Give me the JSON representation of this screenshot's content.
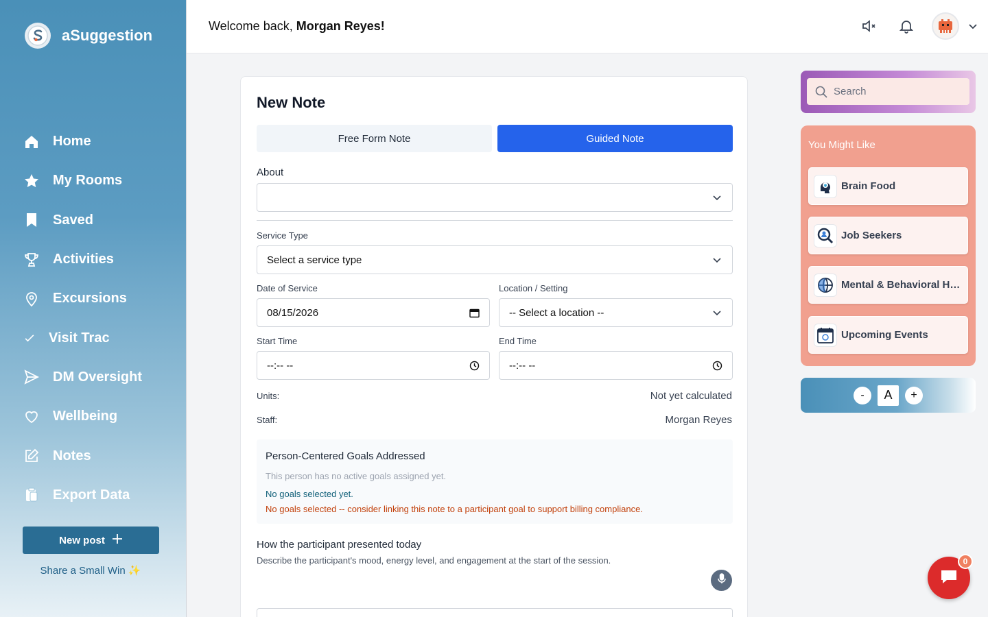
{
  "brand": {
    "name": "aSuggestion",
    "logo_letter": "S"
  },
  "sidebar": {
    "items": [
      {
        "label": "Home",
        "icon": "home-icon"
      },
      {
        "label": "My Rooms",
        "icon": "star-icon"
      },
      {
        "label": "Saved",
        "icon": "bookmark-icon"
      },
      {
        "label": "Activities",
        "icon": "trophy-icon"
      },
      {
        "label": "Excursions",
        "icon": "map-pin-icon"
      },
      {
        "label": "Visit Trac",
        "icon": "check-icon"
      },
      {
        "label": "DM Oversight",
        "icon": "send-icon"
      },
      {
        "label": "Wellbeing",
        "icon": "heart-icon"
      },
      {
        "label": "Notes",
        "icon": "edit-icon"
      },
      {
        "label": "Export Data",
        "icon": "clipboard-icon"
      }
    ],
    "new_post_label": "New post",
    "small_win": "Share a Small Win ✨"
  },
  "header": {
    "welcome_prefix": "Welcome back, ",
    "user_name": "Morgan Reyes!"
  },
  "note": {
    "title": "New Note",
    "tabs": {
      "free_form": "Free Form Note",
      "guided": "Guided Note",
      "active": "guided"
    },
    "about_label": "About",
    "about_value": "",
    "service_type_label": "Service Type",
    "service_type_value": "Select a service type",
    "date_label": "Date of Service",
    "date_value": "08/15/2026",
    "location_label": "Location / Setting",
    "location_value": "-- Select a location --",
    "start_time_label": "Start Time",
    "start_time_value": "--:-- --",
    "end_time_label": "End Time",
    "end_time_value": "--:-- --",
    "units_label": "Units:",
    "units_value": "Not yet calculated",
    "staff_label": "Staff:",
    "staff_value": "Morgan Reyes",
    "goals": {
      "title": "Person-Centered Goals Addressed",
      "empty": "This person has no active goals assigned yet.",
      "selected": "No goals selected yet.",
      "warning": "No goals selected -- consider linking this note to a participant goal to support billing compliance."
    },
    "presented_label": "How the participant presented today",
    "presented_desc": "Describe the participant's mood, energy level, and engagement at the start of the session."
  },
  "search": {
    "placeholder": "Search"
  },
  "you_might_like": {
    "title": "You Might Like",
    "items": [
      {
        "label": "Brain Food",
        "icon": "brain-icon"
      },
      {
        "label": "Job Seekers",
        "icon": "magnifier-person-icon"
      },
      {
        "label": "Mental & Behavioral Health",
        "icon": "globe-icon"
      },
      {
        "label": "Upcoming Events",
        "icon": "calendar-icon"
      }
    ]
  },
  "font_control": {
    "minus": "-",
    "letter": "A",
    "plus": "+"
  },
  "chat": {
    "badge": "0"
  },
  "colors": {
    "primary": "#2563eb",
    "sidebar": "#4a90b8",
    "accent": "#f1a08f",
    "chat": "#dc2b2b"
  }
}
